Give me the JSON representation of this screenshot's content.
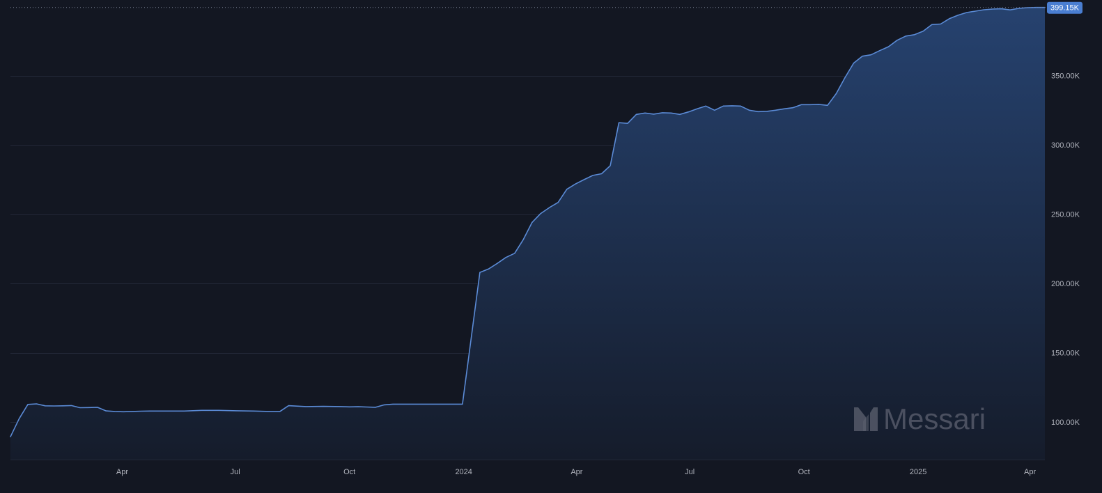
{
  "chart_data": {
    "type": "area",
    "x_unit": "date",
    "y_unit": "count",
    "x": [
      "2023-01-01",
      "2023-01-08",
      "2023-01-15",
      "2023-01-22",
      "2023-01-29",
      "2023-02-05",
      "2023-02-12",
      "2023-02-19",
      "2023-02-26",
      "2023-03-05",
      "2023-03-12",
      "2023-03-19",
      "2023-03-26",
      "2023-04-02",
      "2023-04-09",
      "2023-04-16",
      "2023-04-23",
      "2023-05-07",
      "2023-05-21",
      "2023-06-04",
      "2023-06-18",
      "2023-07-02",
      "2023-07-16",
      "2023-07-23",
      "2023-07-30",
      "2023-08-06",
      "2023-08-13",
      "2023-08-27",
      "2023-09-10",
      "2023-09-24",
      "2023-10-01",
      "2023-10-08",
      "2023-10-15",
      "2023-10-22",
      "2023-10-29",
      "2023-11-05",
      "2023-11-19",
      "2023-12-03",
      "2023-12-17",
      "2023-12-31",
      "2024-01-14",
      "2024-01-21",
      "2024-01-28",
      "2024-02-04",
      "2024-02-11",
      "2024-02-18",
      "2024-02-25",
      "2024-03-03",
      "2024-03-10",
      "2024-03-17",
      "2024-03-24",
      "2024-03-31",
      "2024-04-07",
      "2024-04-14",
      "2024-04-21",
      "2024-04-28",
      "2024-05-05",
      "2024-05-12",
      "2024-05-19",
      "2024-05-26",
      "2024-06-02",
      "2024-06-09",
      "2024-06-16",
      "2024-06-23",
      "2024-06-30",
      "2024-07-07",
      "2024-07-14",
      "2024-07-21",
      "2024-07-28",
      "2024-08-04",
      "2024-08-11",
      "2024-08-18",
      "2024-08-25",
      "2024-09-01",
      "2024-09-08",
      "2024-09-15",
      "2024-09-22",
      "2024-09-29",
      "2024-10-06",
      "2024-10-13",
      "2024-10-20",
      "2024-10-27",
      "2024-11-03",
      "2024-11-10",
      "2024-11-17",
      "2024-11-24",
      "2024-12-01",
      "2024-12-08",
      "2024-12-15",
      "2024-12-22",
      "2024-12-29",
      "2025-01-05",
      "2025-01-12",
      "2025-01-19",
      "2025-01-26",
      "2025-02-02",
      "2025-02-09",
      "2025-02-16",
      "2025-02-23",
      "2025-03-02",
      "2025-03-09",
      "2025-03-16",
      "2025-03-23",
      "2025-03-30",
      "2025-04-06",
      "2025-04-13"
    ],
    "y": [
      89500,
      102500,
      112800,
      113200,
      111800,
      111700,
      111800,
      112000,
      110400,
      110500,
      110700,
      108100,
      107700,
      107500,
      107700,
      107900,
      108000,
      108000,
      108000,
      108500,
      108500,
      108200,
      108000,
      107800,
      107700,
      107700,
      111900,
      111200,
      111400,
      111200,
      111000,
      111100,
      110900,
      110700,
      112500,
      113000,
      113000,
      113000,
      113000,
      113000,
      208000,
      210500,
      214500,
      218800,
      221800,
      231800,
      244000,
      250500,
      254800,
      258500,
      268000,
      271800,
      275000,
      278000,
      279200,
      285000,
      316000,
      315500,
      322000,
      323000,
      322200,
      323200,
      323000,
      322000,
      323800,
      326000,
      328000,
      325000,
      328000,
      328200,
      328000,
      325000,
      324000,
      324200,
      325000,
      326000,
      326800,
      329000,
      329000,
      329200,
      328500,
      337000,
      348500,
      359000,
      364000,
      365000,
      368000,
      370800,
      375500,
      378500,
      379500,
      382000,
      386800,
      387200,
      391000,
      393500,
      395500,
      396500,
      397500,
      398000,
      398200,
      397400,
      398500,
      399000,
      399150,
      399150
    ],
    "ylim": [
      73000,
      400500
    ],
    "y_ticks": [
      100000,
      150000,
      200000,
      250000,
      300000,
      350000
    ],
    "y_tick_labels": [
      "100.00K",
      "150.00K",
      "200.00K",
      "250.00K",
      "300.00K",
      "350.00K"
    ],
    "x_ticks": [
      "2023-04-01",
      "2023-07-01",
      "2023-10-01",
      "2024-01-01",
      "2024-04-01",
      "2024-07-01",
      "2024-10-01",
      "2025-01-01",
      "2025-04-01"
    ],
    "x_tick_labels": [
      "Apr",
      "Jul",
      "Oct",
      "2024",
      "Apr",
      "Jul",
      "Oct",
      "2025",
      "Apr"
    ],
    "last_value": 399150,
    "last_value_label": "399.15K",
    "grid": "horizontal",
    "legend": "none",
    "colors": {
      "background": "#131722",
      "line": "#5b8bd6",
      "area_top": "#26426f",
      "area_bottom": "#151c2b",
      "grid": "#232838",
      "label_bg": "#4a7ed1",
      "tick_text": "#b2b5be"
    }
  },
  "watermark": {
    "text": "Messari",
    "icon": "messari-logo-icon"
  }
}
